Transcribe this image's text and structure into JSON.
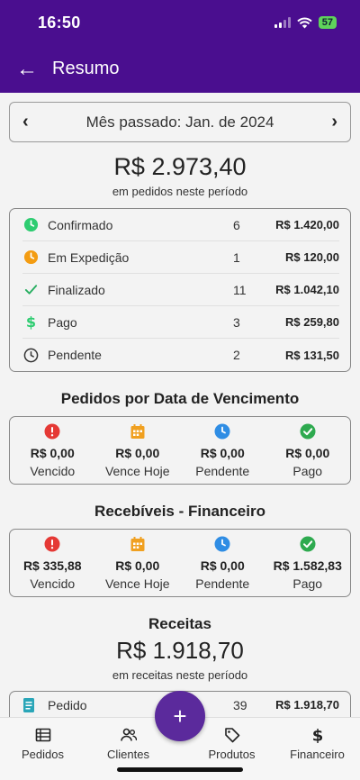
{
  "status_bar": {
    "time": "16:50",
    "battery": "57"
  },
  "app_bar": {
    "title": "Resumo"
  },
  "period": {
    "label": "Mês passado: Jan. de 2024"
  },
  "orders_total": {
    "value": "R$ 2.973,40",
    "caption": "em pedidos neste período"
  },
  "order_statuses": [
    {
      "label": "Confirmado",
      "count": "6",
      "amount": "R$ 1.420,00",
      "icon": "clock-icon",
      "color": "#2ecc71"
    },
    {
      "label": "Em Expedição",
      "count": "1",
      "amount": "R$ 120,00",
      "icon": "clock-icon",
      "color": "#f39c12"
    },
    {
      "label": "Finalizado",
      "count": "11",
      "amount": "R$ 1.042,10",
      "icon": "check-icon",
      "color": "#27ae60"
    },
    {
      "label": "Pago",
      "count": "3",
      "amount": "R$ 259,80",
      "icon": "dollar-icon",
      "color": "#2ecc71"
    },
    {
      "label": "Pendente",
      "count": "2",
      "amount": "R$ 131,50",
      "icon": "clock-outline-icon",
      "color": "#333333"
    }
  ],
  "due_date_section": {
    "title": "Pedidos por Data de Vencimento",
    "cells": [
      {
        "value": "R$ 0,00",
        "label": "Vencido",
        "icon": "alert-icon",
        "color": "#e53935"
      },
      {
        "value": "R$ 0,00",
        "label": "Vence Hoje",
        "icon": "calendar-icon",
        "color": "#f0a020"
      },
      {
        "value": "R$ 0,00",
        "label": "Pendente",
        "icon": "clock-icon",
        "color": "#2f8de4"
      },
      {
        "value": "R$ 0,00",
        "label": "Pago",
        "icon": "check-circle-icon",
        "color": "#2eaa4f"
      }
    ]
  },
  "receivables_section": {
    "title": "Recebíveis - Financeiro",
    "cells": [
      {
        "value": "R$ 335,88",
        "label": "Vencido",
        "icon": "alert-icon",
        "color": "#e53935"
      },
      {
        "value": "R$ 0,00",
        "label": "Vence Hoje",
        "icon": "calendar-icon",
        "color": "#f0a020"
      },
      {
        "value": "R$ 0,00",
        "label": "Pendente",
        "icon": "clock-icon",
        "color": "#2f8de4"
      },
      {
        "value": "R$ 1.582,83",
        "label": "Pago",
        "icon": "check-circle-icon",
        "color": "#2eaa4f"
      }
    ]
  },
  "revenue_section": {
    "title": "Receitas",
    "value": "R$ 1.918,70",
    "caption": "em receitas neste período",
    "row": {
      "label": "Pedido",
      "count": "39",
      "amount": "R$ 1.918,70"
    }
  },
  "bottom_nav": {
    "items": [
      {
        "label": "Pedidos",
        "icon": "list-icon"
      },
      {
        "label": "Clientes",
        "icon": "people-icon"
      },
      {
        "label": "Produtos",
        "icon": "tags-icon"
      },
      {
        "label": "Financeiro",
        "icon": "dollar-icon"
      }
    ],
    "fab": "+"
  }
}
